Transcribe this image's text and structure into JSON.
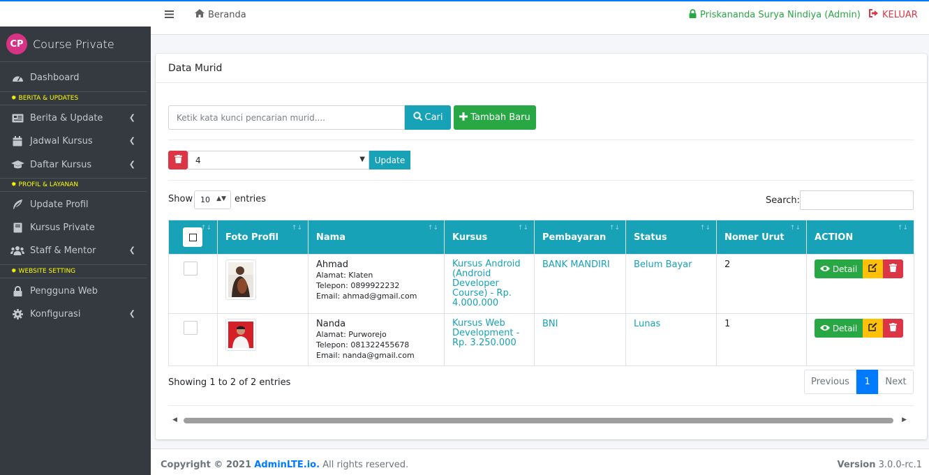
{
  "navbar": {
    "menu_icon": "bars-icon",
    "home_label": "Beranda",
    "user_label": "Priskananda Surya Nindiya (Admin)",
    "logout_label": "KELUAR",
    "colors": {
      "accent": "#007bff",
      "user": "#28a745",
      "logout": "#dc3545"
    }
  },
  "sidebar": {
    "brand_logo": "CP",
    "brand_name": "Course Private",
    "items": [
      {
        "label": "Dashboard",
        "icon": "tachometer-icon"
      },
      {
        "label": "Berita & Update",
        "icon": "newspaper-icon",
        "has_children": true
      },
      {
        "label": "Jadwal Kursus",
        "icon": "calendar-icon",
        "has_children": true
      },
      {
        "label": "Daftar Kursus",
        "icon": "graduation-cap-icon",
        "has_children": true
      },
      {
        "label": "Update Profil",
        "icon": "feather-icon"
      },
      {
        "label": "Kursus Private",
        "icon": "book-icon"
      },
      {
        "label": "Staff & Mentor",
        "icon": "users-icon",
        "has_children": true
      },
      {
        "label": "Pengguna Web",
        "icon": "lock-icon"
      },
      {
        "label": "Konfigurasi",
        "icon": "cog-icon",
        "has_children": true
      }
    ],
    "headers": [
      "BERITA & UPDATES",
      "PROFIL & LAYANAN",
      "WEBSITE SETTING"
    ]
  },
  "card": {
    "title": "Data Murid",
    "search_placeholder": "Ketik kata kunci pencarian murid....",
    "cari_label": "Cari",
    "tambah_label": "Tambah Baru",
    "bulk_select_value": "4",
    "update_label": "Update",
    "show_label": "Show",
    "show_value": "10",
    "entries_label": "entries",
    "search_label": "Search:"
  },
  "table": {
    "columns": [
      "Foto Profil",
      "Nama",
      "Kursus",
      "Pembayaran",
      "Status",
      "Nomer Urut",
      "ACTION"
    ],
    "rows": [
      {
        "nama": "Ahmad",
        "alamat": "Alamat: Klaten",
        "telepon": "Telepon: 0899922232",
        "email": "Email: ahmad@gmail.com",
        "kursus": "Kursus Android (Android Developer Course) - Rp. 4.000.000",
        "pembayaran": "BANK MANDIRI",
        "status": "Belum Bayar",
        "nomer_urut": "2",
        "detail_label": "Detail"
      },
      {
        "nama": "Nanda",
        "alamat": "Alamat: Purworejo",
        "telepon": "Telepon: 081322455678",
        "email": "Email: nanda@gmail.com",
        "kursus": "Kursus Web Development - Rp. 3.250.000",
        "pembayaran": "BNI",
        "status": "Lunas",
        "nomer_urut": "1",
        "detail_label": "Detail"
      }
    ]
  },
  "pagination": {
    "showing": "Showing 1 to 2 of 2 entries",
    "previous": "Previous",
    "current_page": "1",
    "next": "Next"
  },
  "footer": {
    "copyright_prefix": "Copyright © 2021",
    "copyright_link": "AdminLTE.io.",
    "copyright_suffix": "All rights reserved.",
    "version_label": "Version",
    "version_value": "3.0.0-rc.1"
  }
}
